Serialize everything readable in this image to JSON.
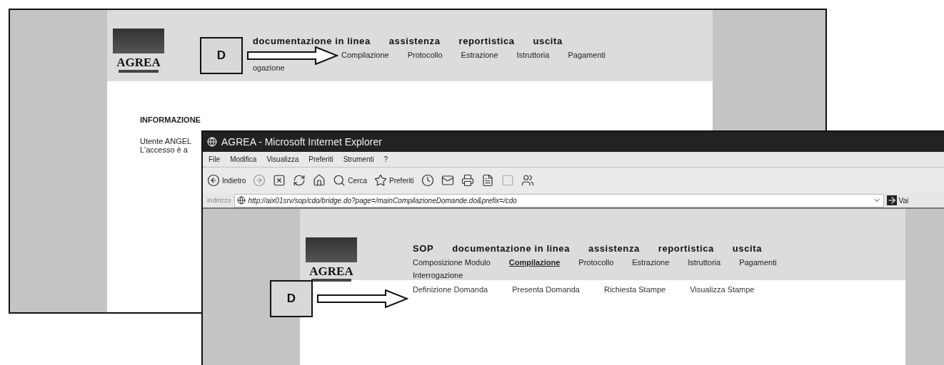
{
  "back_window": {
    "logo": "AGREA",
    "header_links": [
      "documentazione in linea",
      "assistenza",
      "reportistica",
      "uscita"
    ],
    "nav": [
      "Compilazione",
      "Protocollo",
      "Estrazione",
      "Istruttoria",
      "Pagamenti"
    ],
    "nav_second_row": "ogazione",
    "info": {
      "title": "INFORMAZIONE",
      "lines": [
        "Utente ANGEL",
        "L'accesso è a"
      ]
    },
    "callout": "D"
  },
  "front_window": {
    "title": "AGREA - Microsoft Internet Explorer",
    "menu": [
      "File",
      "Modifica",
      "Visualizza",
      "Preferiti",
      "Strumenti",
      "?"
    ],
    "toolbar": [
      {
        "kind": "back",
        "label": "Indietro"
      },
      {
        "kind": "forward"
      },
      {
        "kind": "stop"
      },
      {
        "kind": "refresh"
      },
      {
        "kind": "home"
      },
      {
        "kind": "search",
        "label": "Cerca"
      },
      {
        "kind": "favorites",
        "label": "Preferiti"
      },
      {
        "kind": "history"
      },
      {
        "kind": "mail"
      },
      {
        "kind": "print"
      },
      {
        "kind": "edit"
      },
      {
        "kind": "blank"
      },
      {
        "kind": "messenger"
      }
    ],
    "address": {
      "label": "Indirizzo",
      "url": "http://aix01srv/sop/cdo/bridge.do?page=/mainCompilazioneDomande.do&prefix=/cdo",
      "go": "Vai"
    },
    "logo": "AGREA",
    "header_links": [
      "SOP",
      "documentazione in linea",
      "assistenza",
      "reportistica",
      "uscita"
    ],
    "nav": [
      {
        "label": "Composizione Modulo",
        "selected": false
      },
      {
        "label": "Compilazione",
        "selected": true
      },
      {
        "label": "Protocollo",
        "selected": false
      },
      {
        "label": "Estrazione",
        "selected": false
      },
      {
        "label": "Istruttoria",
        "selected": false
      },
      {
        "label": "Pagamenti",
        "selected": false
      }
    ],
    "nav_second_row": "Interrogazione",
    "subnav": [
      "Definizione Domanda",
      "Presenta Domanda",
      "Richiesta Stampe",
      "Visualizza Stampe"
    ],
    "callout": "D"
  }
}
